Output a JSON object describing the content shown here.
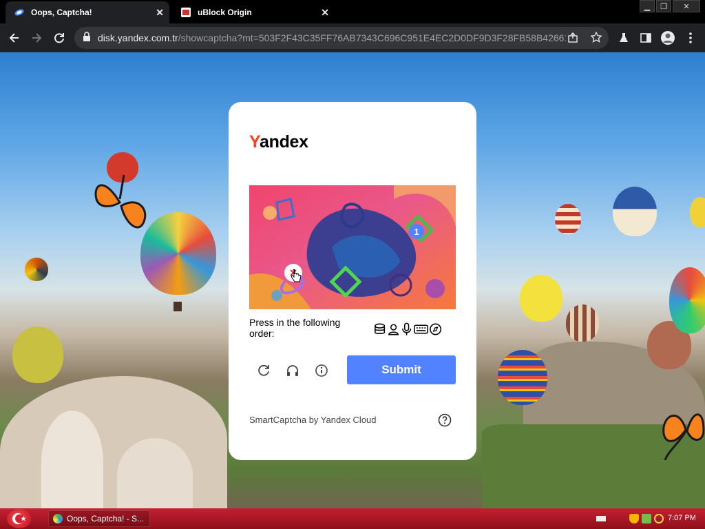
{
  "tabs": [
    {
      "title": "Oops, Captcha!",
      "active": true
    },
    {
      "title": "uBlock Origin",
      "active": false
    }
  ],
  "address_bar": {
    "host": "disk.yandex.com.tr",
    "path": "/showcaptcha?mt=503F2F43C35FF76AB7343C696C951E4EC2D0DF9D3F28FB58B42661..."
  },
  "captcha": {
    "logo": {
      "first": "Y",
      "rest": "andex"
    },
    "prompt": "Press in the following order:",
    "order_icons": [
      "db-icon",
      "user-icon",
      "mic-icon",
      "keyboard-icon",
      "compass-icon"
    ],
    "selected_marker": "1",
    "submit_label": "Submit",
    "footer": "SmartCaptcha by Yandex Cloud"
  },
  "taskbar": {
    "window_label": "Oops, Captcha! - S...",
    "clock": "7:07 PM"
  },
  "colors": {
    "submit_bg": "#5282ff",
    "yandex_red": "#fc3f1d",
    "taskbar": "#c42030"
  }
}
